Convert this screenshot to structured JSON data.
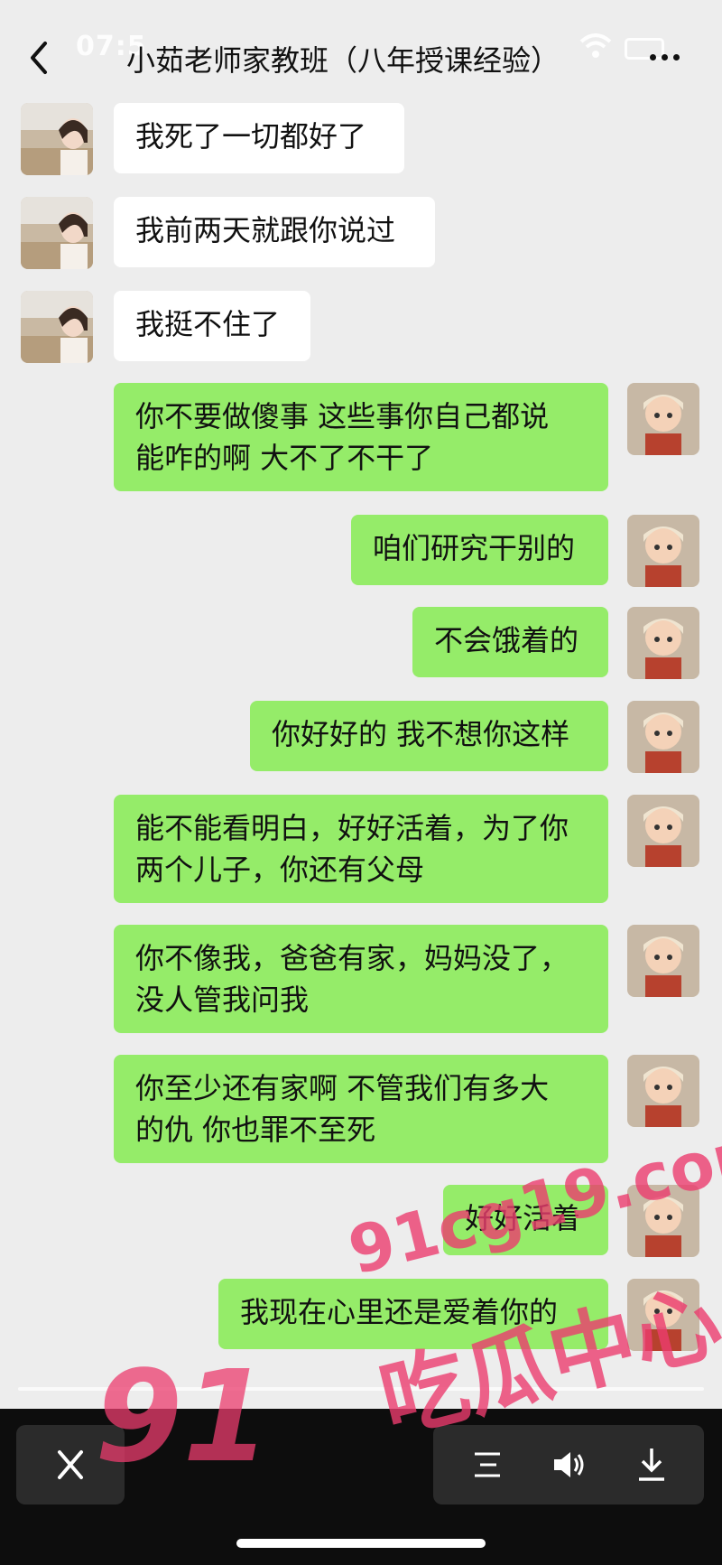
{
  "header": {
    "status_time": "07:5",
    "title": "小茹老师家教班（八年授课经验）"
  },
  "messages": [
    {
      "side": "in",
      "text": "我死了一切都好了"
    },
    {
      "side": "in",
      "text": "我前两天就跟你说过"
    },
    {
      "side": "in",
      "text": "我挺不住了"
    },
    {
      "side": "out",
      "text": "你不要做傻事 这些事你自己都说\n能咋的啊 大不了不干了"
    },
    {
      "side": "out",
      "text": "咱们研究干别的"
    },
    {
      "side": "out",
      "text": "不会饿着的"
    },
    {
      "side": "out",
      "text": "你好好的 我不想你这样"
    },
    {
      "side": "out",
      "text": "能不能看明白，好好活着，为了你\n两个儿子，你还有父母"
    },
    {
      "side": "out",
      "text": "你不像我，爸爸有家，妈妈没了，\n没人管我问我"
    },
    {
      "side": "out",
      "text": "你至少还有家啊 不管我们有多大\n的仇 你也罪不至死"
    },
    {
      "side": "out",
      "text": "好好活着"
    },
    {
      "side": "out",
      "text": "我现在心里还是爱着你的"
    }
  ],
  "watermark": {
    "number": "91",
    "site": "91cg19.com",
    "label": "吃瓜中心"
  },
  "player": {
    "close_icon": "close-icon",
    "icons": [
      "list-icon",
      "volume-icon",
      "download-icon"
    ]
  },
  "colors": {
    "background": "#ededed",
    "incoming_bubble": "#ffffff",
    "outgoing_bubble": "#95ec69",
    "watermark": "#eb3c6e"
  }
}
